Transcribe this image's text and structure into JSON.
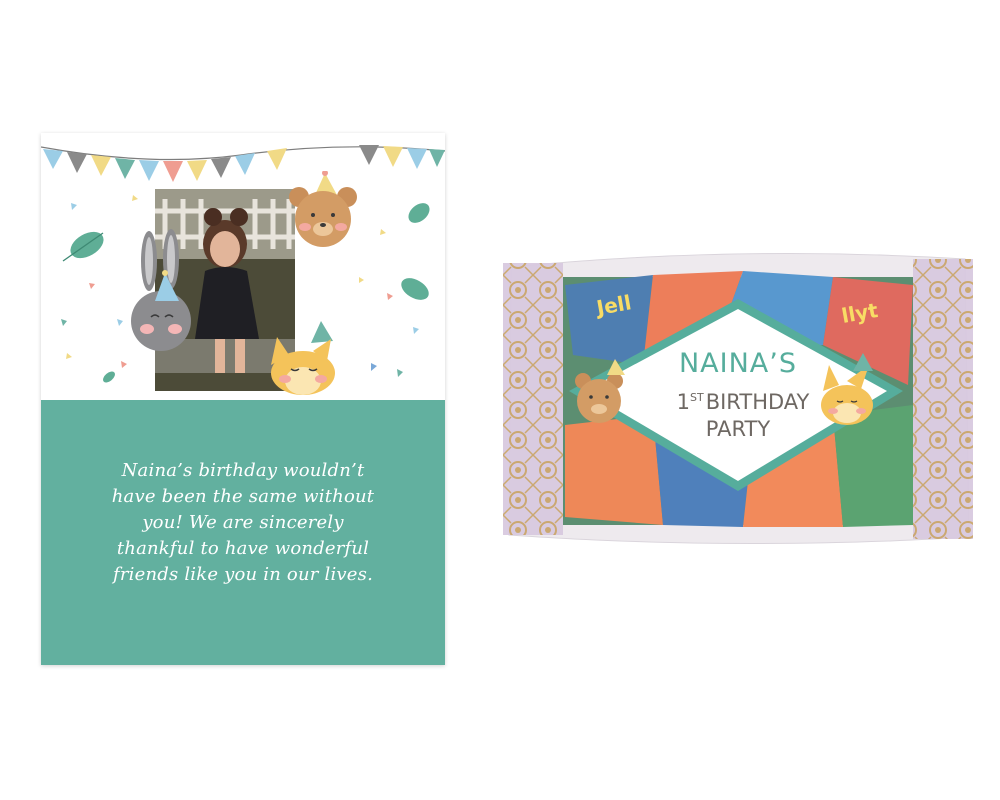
{
  "card": {
    "message_lines": [
      "Naina’s birthday wouldn’t",
      "have been the same without",
      "you! We are sincerely",
      "thankful to have wonderful",
      "friends like you in our lives."
    ]
  },
  "pack_label": {
    "name": "NAINA’S",
    "ordinal_number": "1",
    "ordinal_suffix": "ST",
    "line2_rest": "BIRTHDAY",
    "line3": "PARTY"
  },
  "colors": {
    "card_green": "#62b09f",
    "label_green": "#56ad9c",
    "label_text": "#6e6863",
    "gold": "#c9a56a",
    "lilac": "#cfbfd8"
  }
}
